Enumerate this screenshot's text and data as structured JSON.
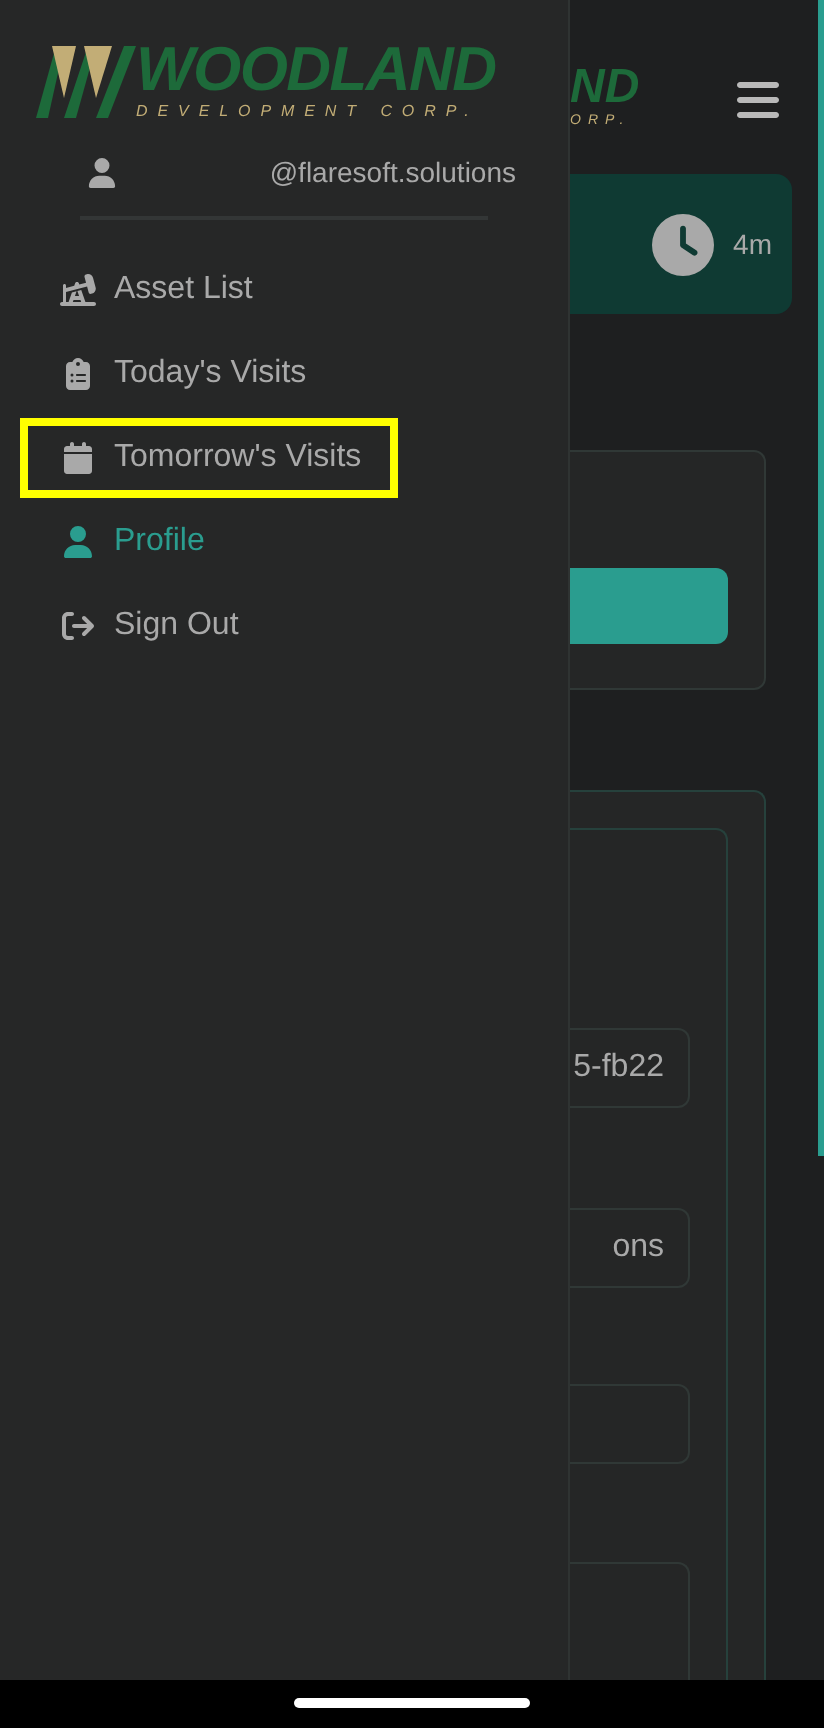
{
  "drawer": {
    "logo": {
      "name": "WOODLAND",
      "subtitle": "DEVELOPMENT CORP."
    },
    "user": {
      "email": "@flaresoft.solutions"
    },
    "menu": [
      {
        "label": "Asset List",
        "kind": "assets",
        "selected": false,
        "highlighted": false
      },
      {
        "label": "Today's Visits",
        "kind": "today",
        "selected": false,
        "highlighted": false
      },
      {
        "label": "Tomorrow's Visits",
        "kind": "tomorrow",
        "selected": false,
        "highlighted": true
      },
      {
        "label": "Profile",
        "kind": "profile",
        "selected": true,
        "highlighted": false
      },
      {
        "label": "Sign Out",
        "kind": "signout",
        "selected": false,
        "highlighted": false
      }
    ]
  },
  "background": {
    "logo_fragment": {
      "name": "ND",
      "subtitle": "ORP."
    },
    "timer": "4m",
    "fields": [
      {
        "value": "5-fb22"
      },
      {
        "value": "ons"
      }
    ]
  }
}
